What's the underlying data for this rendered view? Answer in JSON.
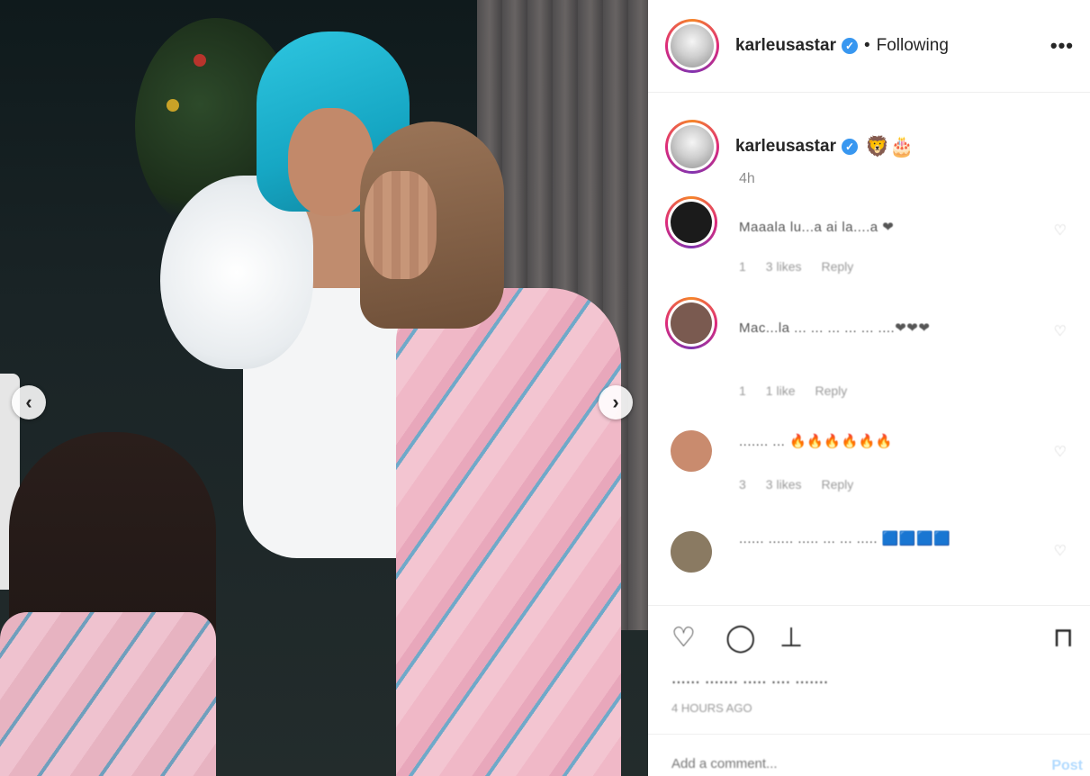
{
  "post": {
    "username": "karleusastar",
    "verified_icon": "verified-badge-icon",
    "follow_state": "Following",
    "separator": "•",
    "more_icon": "•••",
    "caption_emoji": "🦁🎂",
    "time": "4h"
  },
  "photo": {
    "prev_arrow": "‹",
    "next_arrow": "›",
    "colors": {
      "wig": "#16a7c4",
      "dress_pink": "#f0b8c7",
      "dress_white": "#f4f5f6"
    }
  },
  "comments": [
    {
      "text": "Maaala lu...a ai la....a ❤",
      "meta": [
        "1",
        "3 likes",
        "Reply"
      ],
      "avatar_color": "#1b1b1b",
      "ring": true
    },
    {
      "text": "Mac...la ... ... ... ... ... ....❤❤❤",
      "meta": [
        "1",
        "1 like",
        "Reply"
      ],
      "avatar_color": "#7a5a50",
      "ring": true
    },
    {
      "text": "....... ... 🔥🔥🔥🔥🔥🔥",
      "meta": [
        "3",
        "3 likes",
        "Reply"
      ],
      "avatar_color": "#c98b6e",
      "ring": false
    },
    {
      "text": "...... ...... ..... ... ... ..... 🟦🟦🟦🟦",
      "meta": [],
      "avatar_color": "#8a7a62",
      "ring": false
    }
  ],
  "actions": {
    "like_icon": "♡",
    "comment_icon": "◯",
    "share_icon": "⊥",
    "save_icon": "⊓",
    "likes_text": "...... ....... ..... .... .......",
    "time_text": "4 HOURS AGO"
  },
  "add_comment": {
    "placeholder": "Add a comment...",
    "post_label": "Post"
  }
}
